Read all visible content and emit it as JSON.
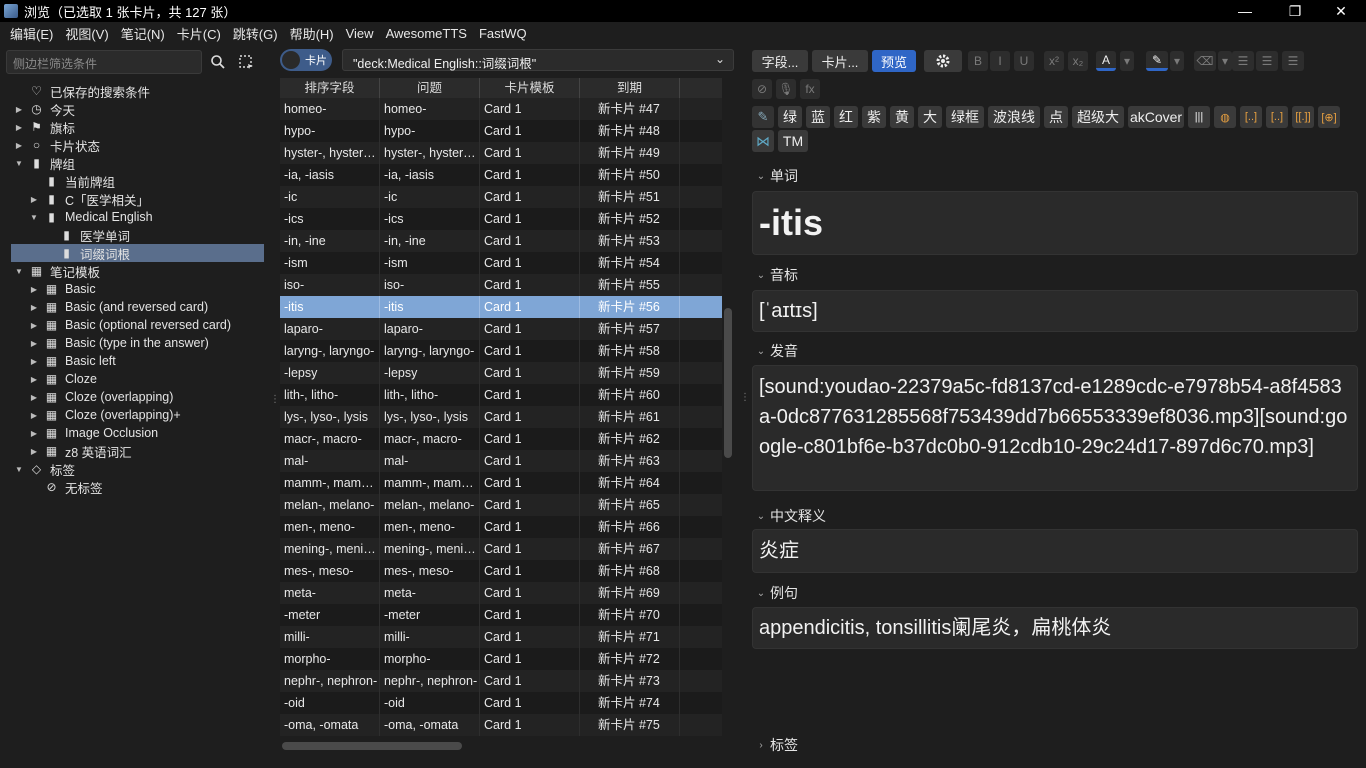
{
  "window": {
    "title": "浏览（已选取 1 张卡片，共 127 张）",
    "controls": [
      "—",
      "❐",
      "✕"
    ]
  },
  "menubar": [
    "编辑(E)",
    "视图(V)",
    "笔记(N)",
    "卡片(C)",
    "跳转(G)",
    "帮助(H)",
    "View",
    "AwesomeTTS",
    "FastWQ"
  ],
  "sidebar": {
    "search_placeholder": "侧边栏筛选条件",
    "tree": [
      {
        "label": "已保存的搜索条件",
        "icon": "heart-icon",
        "glyph": "♡",
        "depth": 0,
        "arrow": ""
      },
      {
        "label": "今天",
        "icon": "clock-icon",
        "glyph": "◷",
        "depth": 0,
        "arrow": "▶"
      },
      {
        "label": "旗标",
        "icon": "flag-icon",
        "glyph": "⚑",
        "depth": 0,
        "arrow": "▶"
      },
      {
        "label": "卡片状态",
        "icon": "circle-icon",
        "glyph": "○",
        "depth": 0,
        "arrow": "▶"
      },
      {
        "label": "牌组",
        "icon": "deck-icon",
        "glyph": "▮",
        "depth": 0,
        "arrow": "▼"
      },
      {
        "label": "当前牌组",
        "icon": "current-deck-icon",
        "glyph": "▮",
        "depth": 1,
        "arrow": ""
      },
      {
        "label": "C「医学相关」",
        "icon": "deck-icon",
        "glyph": "▮",
        "depth": 1,
        "arrow": "▶"
      },
      {
        "label": "Medical English",
        "icon": "deck-icon",
        "glyph": "▮",
        "depth": 1,
        "arrow": "▼"
      },
      {
        "label": "医学单词",
        "icon": "deck-icon",
        "glyph": "▮",
        "depth": 2,
        "arrow": ""
      },
      {
        "label": "词缀词根",
        "icon": "deck-icon",
        "glyph": "▮",
        "depth": 2,
        "arrow": "",
        "selected": true
      },
      {
        "label": "笔记模板",
        "icon": "notetype-icon",
        "glyph": "▦",
        "depth": 0,
        "arrow": "▼"
      },
      {
        "label": "Basic",
        "icon": "notetype-icon",
        "glyph": "▦",
        "depth": 1,
        "arrow": "▶"
      },
      {
        "label": "Basic (and reversed card)",
        "icon": "notetype-icon",
        "glyph": "▦",
        "depth": 1,
        "arrow": "▶"
      },
      {
        "label": "Basic (optional reversed card)",
        "icon": "notetype-icon",
        "glyph": "▦",
        "depth": 1,
        "arrow": "▶"
      },
      {
        "label": "Basic (type in the answer)",
        "icon": "notetype-icon",
        "glyph": "▦",
        "depth": 1,
        "arrow": "▶"
      },
      {
        "label": "Basic left",
        "icon": "notetype-icon",
        "glyph": "▦",
        "depth": 1,
        "arrow": "▶"
      },
      {
        "label": "Cloze",
        "icon": "notetype-icon",
        "glyph": "▦",
        "depth": 1,
        "arrow": "▶"
      },
      {
        "label": "Cloze (overlapping)",
        "icon": "notetype-icon",
        "glyph": "▦",
        "depth": 1,
        "arrow": "▶"
      },
      {
        "label": "Cloze (overlapping)+",
        "icon": "notetype-icon",
        "glyph": "▦",
        "depth": 1,
        "arrow": "▶"
      },
      {
        "label": "Image Occlusion",
        "icon": "notetype-icon",
        "glyph": "▦",
        "depth": 1,
        "arrow": "▶"
      },
      {
        "label": "z8 英语词汇",
        "icon": "notetype-icon",
        "glyph": "▦",
        "depth": 1,
        "arrow": "▶"
      },
      {
        "label": "标签",
        "icon": "tag-icon",
        "glyph": "◇",
        "depth": 0,
        "arrow": "▼"
      },
      {
        "label": "无标签",
        "icon": "no-tag-icon",
        "glyph": "⊘",
        "depth": 1,
        "arrow": ""
      }
    ]
  },
  "cardlist": {
    "toggle_label": "卡片",
    "query": "\"deck:Medical English::词缀词根\"",
    "columns": [
      "排序字段",
      "问题",
      "卡片模板",
      "到期"
    ],
    "rows": [
      [
        "homeo-",
        "homeo-",
        "Card 1",
        "新卡片 #47"
      ],
      [
        "hypo-",
        "hypo-",
        "Card 1",
        "新卡片 #48"
      ],
      [
        "hyster-, hyster…",
        "hyster-, hyster…",
        "Card 1",
        "新卡片 #49"
      ],
      [
        "-ia, -iasis",
        "-ia, -iasis",
        "Card 1",
        "新卡片 #50"
      ],
      [
        "-ic",
        "-ic",
        "Card 1",
        "新卡片 #51"
      ],
      [
        "-ics",
        "-ics",
        "Card 1",
        "新卡片 #52"
      ],
      [
        "-in, -ine",
        "-in, -ine",
        "Card 1",
        "新卡片 #53"
      ],
      [
        "-ism",
        "-ism",
        "Card 1",
        "新卡片 #54"
      ],
      [
        "iso-",
        "iso-",
        "Card 1",
        "新卡片 #55"
      ],
      [
        "-itis",
        "-itis",
        "Card 1",
        "新卡片 #56"
      ],
      [
        "laparo-",
        "laparo-",
        "Card 1",
        "新卡片 #57"
      ],
      [
        "laryng-, laryngo-",
        "laryng-, laryngo-",
        "Card 1",
        "新卡片 #58"
      ],
      [
        "-lepsy",
        "-lepsy",
        "Card 1",
        "新卡片 #59"
      ],
      [
        "lith-, litho-",
        "lith-, litho-",
        "Card 1",
        "新卡片 #60"
      ],
      [
        "lys-, lyso-, lysis",
        "lys-, lyso-, lysis",
        "Card 1",
        "新卡片 #61"
      ],
      [
        "macr-, macro-",
        "macr-, macro-",
        "Card 1",
        "新卡片 #62"
      ],
      [
        "mal-",
        "mal-",
        "Card 1",
        "新卡片 #63"
      ],
      [
        "mamm-, mam…",
        "mamm-, mam…",
        "Card 1",
        "新卡片 #64"
      ],
      [
        "melan-, melano-",
        "melan-, melano-",
        "Card 1",
        "新卡片 #65"
      ],
      [
        "men-, meno-",
        "men-, meno-",
        "Card 1",
        "新卡片 #66"
      ],
      [
        "mening-, meni…",
        "mening-, meni…",
        "Card 1",
        "新卡片 #67"
      ],
      [
        "mes-, meso-",
        "mes-, meso-",
        "Card 1",
        "新卡片 #68"
      ],
      [
        "meta-",
        "meta-",
        "Card 1",
        "新卡片 #69"
      ],
      [
        "-meter",
        "-meter",
        "Card 1",
        "新卡片 #70"
      ],
      [
        "milli-",
        "milli-",
        "Card 1",
        "新卡片 #71"
      ],
      [
        "morpho-",
        "morpho-",
        "Card 1",
        "新卡片 #72"
      ],
      [
        "nephr-, nephron-",
        "nephr-, nephron-",
        "Card 1",
        "新卡片 #73"
      ],
      [
        "-oid",
        "-oid",
        "Card 1",
        "新卡片 #74"
      ],
      [
        "-oma, -omata",
        "-oma, -omata",
        "Card 1",
        "新卡片 #75"
      ]
    ],
    "selected_index": 9
  },
  "editor": {
    "toolbar_main": [
      {
        "label": "字段...",
        "name": "fields-button"
      },
      {
        "label": "卡片...",
        "name": "cards-button"
      },
      {
        "label": "预览",
        "name": "preview-button",
        "active": true
      }
    ],
    "fmt_buttons": [
      "B",
      "I",
      "U",
      "x²",
      "x₂",
      "A",
      "▾",
      "✎",
      "▾",
      "⌫",
      "▾",
      "☰",
      "☰",
      "☰"
    ],
    "fmt_row2": [
      "⊘",
      "🎙",
      "fx"
    ],
    "addon_buttons": [
      "绿",
      "蓝",
      "红",
      "紫",
      "黄",
      "大",
      "绿框",
      "波浪线",
      "点",
      "超级大",
      "akCover",
      "|||",
      "◍",
      "[..]",
      "[..]",
      "[[.]]",
      "[⊕]"
    ],
    "addon_row2": [
      "⋈",
      "TM"
    ],
    "fields": [
      {
        "name": "单词",
        "value": "-itis"
      },
      {
        "name": "音标",
        "value": "[ˈaɪtɪs]"
      },
      {
        "name": "发音",
        "value": "[sound:youdao-22379a5c-fd8137cd-e1289cdc-e7978b54-a8f4583a-0dc877631285568f753439dd7b66553339ef8036.mp3][sound:google-c801bf6e-b37dc0b0-912cdb10-29c24d17-897d6c70.mp3]"
      },
      {
        "name": "中文释义",
        "value": "炎症"
      },
      {
        "name": "例句",
        "value": "appendicitis, tonsillitis阑尾炎，扁桃体炎"
      }
    ],
    "tags_label": "标签"
  }
}
